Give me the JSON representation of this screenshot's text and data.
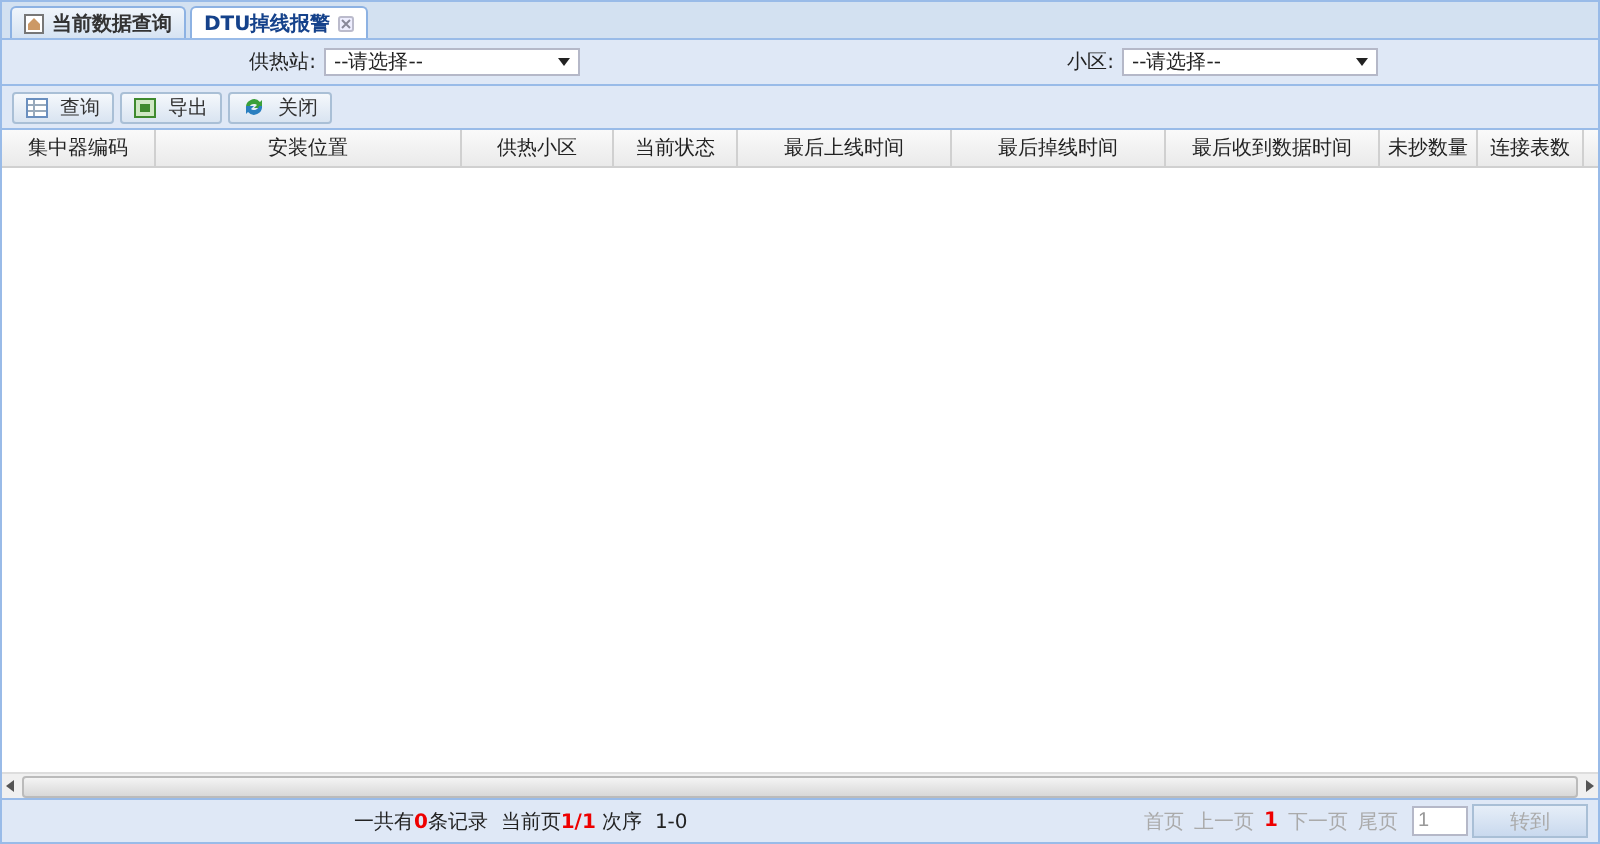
{
  "tabs": [
    {
      "label": "当前数据查询",
      "selected": false,
      "closable": false
    },
    {
      "label": "DTU掉线报警",
      "selected": true,
      "closable": true
    }
  ],
  "filters": [
    {
      "label": "供热站:",
      "value": "--请选择--"
    },
    {
      "label": "小区:",
      "value": "--请选择--"
    }
  ],
  "toolbar": [
    {
      "label": "查询",
      "kind": "table"
    },
    {
      "label": "导出",
      "kind": "excel"
    },
    {
      "label": "关闭",
      "kind": "close"
    }
  ],
  "table": {
    "columns": [
      "集中器编码",
      "安装位置",
      "供热小区",
      "当前状态",
      "最后上线时间",
      "最后掉线时间",
      "最后收到数据时间",
      "未抄数量",
      "连接表数"
    ]
  },
  "footer": {
    "summary": "一共有**0**条记录  当前页**1/1** 次序  1-0",
    "pager": [
      {
        "label": "首页",
        "disabled": true
      },
      {
        "label": "上一页",
        "disabled": true
      },
      {
        "label": "1",
        "kind": "current"
      },
      {
        "label": "下一页",
        "disabled": true
      },
      {
        "label": "尾页",
        "disabled": true
      }
    ],
    "page_input": "1",
    "go_button": "转到"
  }
}
